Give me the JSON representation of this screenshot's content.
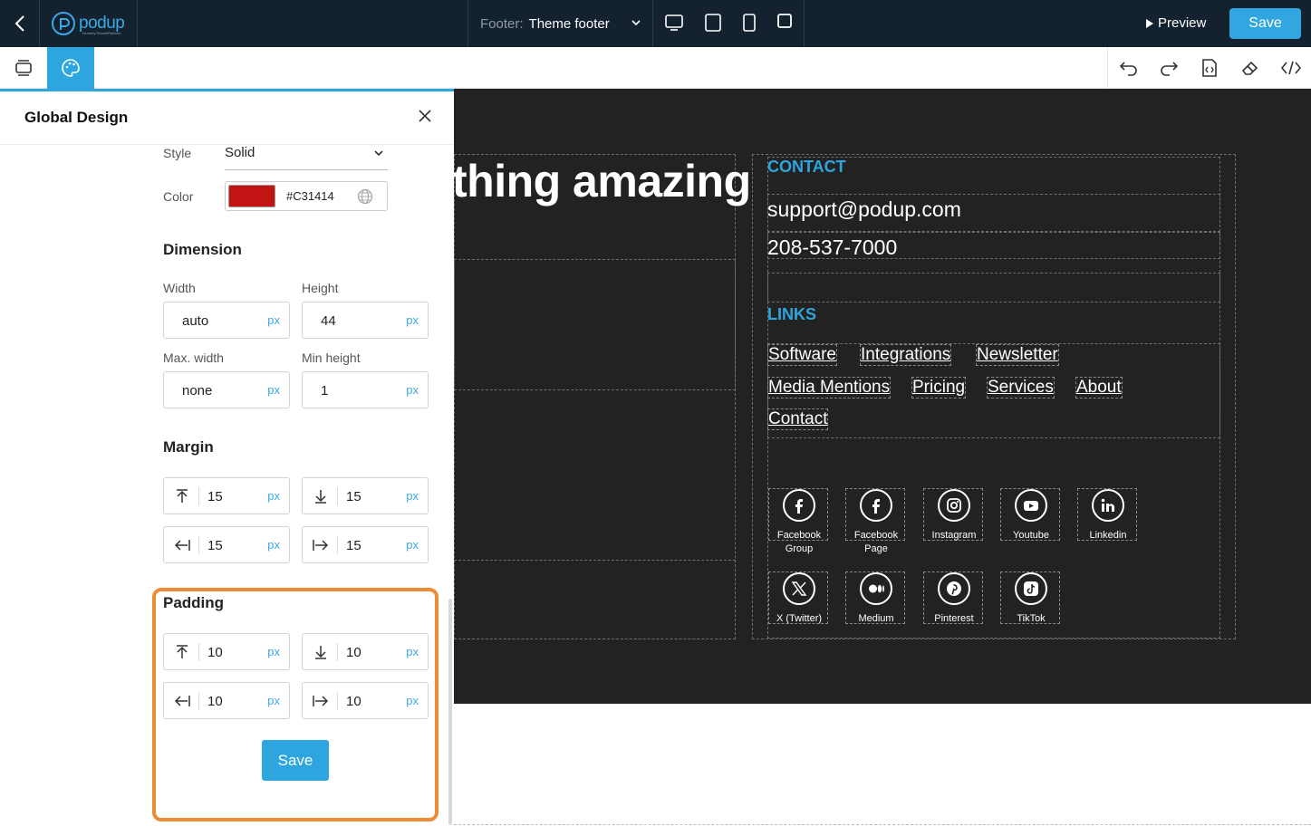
{
  "topbar": {
    "logo_text": "podup",
    "logo_sub": "formerly ShowitPlatform",
    "footer_label": "Footer:",
    "footer_value": "Theme footer",
    "preview_label": "Preview",
    "save_label": "Save"
  },
  "panel": {
    "title": "Global Design",
    "style_label": "Style",
    "style_value": "Solid",
    "color_label": "Color",
    "color_hex": "#C31414",
    "dimension_title": "Dimension",
    "width_label": "Width",
    "width_value": "auto",
    "height_label": "Height",
    "height_value": "44",
    "maxwidth_label": "Max. width",
    "maxwidth_value": "none",
    "minheight_label": "Min height",
    "minheight_value": "1",
    "unit": "px",
    "margin_title": "Margin",
    "margin": {
      "top": "15",
      "bottom": "15",
      "left": "15",
      "right": "15"
    },
    "padding_title": "Padding",
    "padding": {
      "top": "10",
      "bottom": "10",
      "left": "10",
      "right": "10"
    },
    "save_label": "Save"
  },
  "canvas": {
    "heading": "thing amazing",
    "contact_title": "CONTACT",
    "email": "support@podup.com",
    "phone": "208-537-7000",
    "links_title": "LINKS",
    "links": [
      "Software",
      "Integrations",
      "Newsletter",
      "Media Mentions",
      "Pricing",
      "Services",
      "About",
      "Contact"
    ],
    "socials": [
      {
        "label": "Facebook Group",
        "icon": "facebook-icon"
      },
      {
        "label": "Facebook Page",
        "icon": "facebook-icon"
      },
      {
        "label": "Instagram",
        "icon": "instagram-icon"
      },
      {
        "label": "Youtube",
        "icon": "youtube-icon"
      },
      {
        "label": "Linkedin",
        "icon": "linkedin-icon"
      },
      {
        "label": "X (Twitter)",
        "icon": "x-twitter-icon"
      },
      {
        "label": "Medium",
        "icon": "medium-icon"
      },
      {
        "label": "Pinterest",
        "icon": "pinterest-icon"
      },
      {
        "label": "TikTok",
        "icon": "tiktok-icon"
      }
    ]
  },
  "colors": {
    "accent": "#2da6df",
    "topbar": "#14222f",
    "canvas_dark": "#222222",
    "highlight": "#ee8b35",
    "swatch": "#C31414"
  }
}
